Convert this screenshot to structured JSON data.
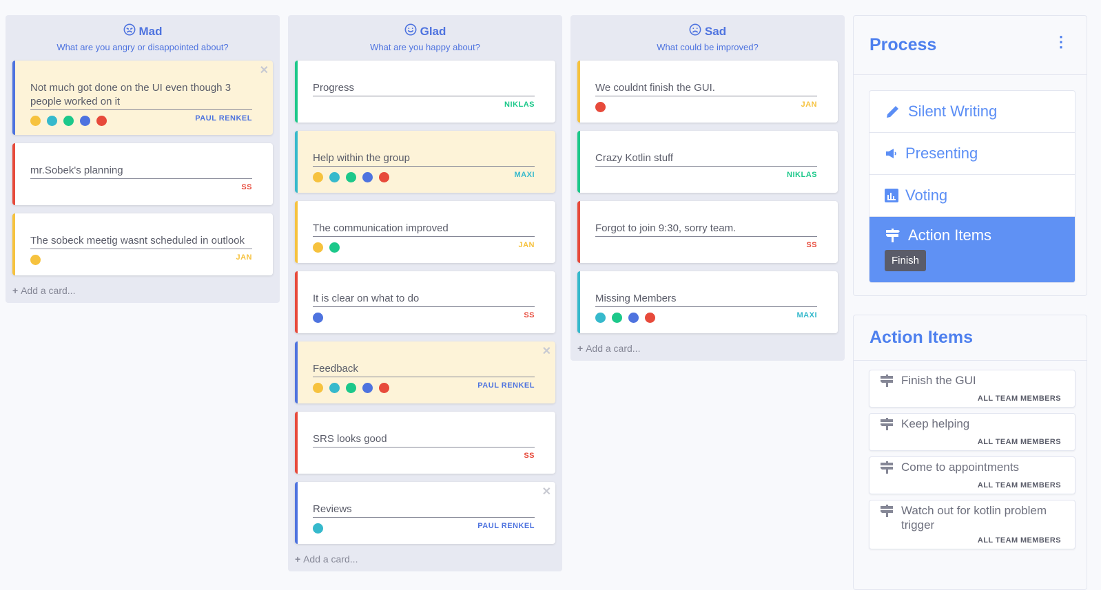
{
  "colors": {
    "yellow": "#f6c23e",
    "teal": "#36b9cc",
    "green": "#1cc88a",
    "blue": "#4e73df",
    "red": "#e74a3b"
  },
  "columns": [
    {
      "title": "Mad",
      "icon": "angry-face-icon",
      "subtitle": "What are you angry or disappointed about?",
      "add_label": "Add a card...",
      "cards": [
        {
          "text": "Not much got done on the UI even though 3 people worked on it",
          "author": "PAUL RENKEL",
          "color": "blue",
          "highlight": true,
          "closable": true,
          "votes": [
            "yellow",
            "teal",
            "green",
            "blue",
            "red"
          ]
        },
        {
          "text": "mr.Sobek's planning",
          "author": "SS",
          "color": "red",
          "votes": []
        },
        {
          "text": "The sobeck meetig wasnt scheduled in outlook",
          "author": "JAN",
          "color": "yellow",
          "votes": [
            "yellow"
          ]
        }
      ]
    },
    {
      "title": "Glad",
      "icon": "smile-face-icon",
      "subtitle": "What are you happy about?",
      "add_label": "Add a card...",
      "cards": [
        {
          "text": "Progress",
          "author": "NIKLAS",
          "color": "green",
          "votes": []
        },
        {
          "text": "Help within the group",
          "author": "MAXI",
          "color": "teal",
          "highlight": true,
          "votes": [
            "yellow",
            "teal",
            "green",
            "blue",
            "red"
          ]
        },
        {
          "text": "The communication improved",
          "author": "JAN",
          "color": "yellow",
          "votes": [
            "yellow",
            "green"
          ]
        },
        {
          "text": "It is clear on what to do",
          "author": "SS",
          "color": "red",
          "votes": [
            "blue"
          ]
        },
        {
          "text": "Feedback",
          "author": "PAUL RENKEL",
          "color": "blue",
          "highlight": true,
          "closable": true,
          "votes": [
            "yellow",
            "teal",
            "green",
            "blue",
            "red"
          ]
        },
        {
          "text": "SRS looks good",
          "author": "SS",
          "color": "red",
          "votes": []
        },
        {
          "text": "Reviews",
          "author": "PAUL RENKEL",
          "color": "blue",
          "closable": true,
          "votes": [
            "teal"
          ]
        }
      ]
    },
    {
      "title": "Sad",
      "icon": "sad-face-icon",
      "subtitle": "What could be improved?",
      "add_label": "Add a card...",
      "cards": [
        {
          "text": "We couldnt finish the GUI.",
          "author": "JAN",
          "color": "yellow",
          "votes": [
            "red"
          ]
        },
        {
          "text": "Crazy Kotlin stuff",
          "author": "NIKLAS",
          "color": "green",
          "votes": []
        },
        {
          "text": "Forgot to join 9:30, sorry team.",
          "author": "SS",
          "color": "red",
          "votes": []
        },
        {
          "text": "Missing Members",
          "author": "MAXI",
          "color": "teal",
          "votes": [
            "teal",
            "green",
            "blue",
            "red"
          ]
        }
      ]
    }
  ],
  "process": {
    "title": "Process",
    "steps": [
      {
        "label": "Silent Writing",
        "icon": "pencil-icon"
      },
      {
        "label": "Presenting",
        "icon": "megaphone-icon"
      },
      {
        "label": "Voting",
        "icon": "bar-chart-icon"
      },
      {
        "label": "Action Items",
        "icon": "signpost-icon",
        "active": true
      }
    ],
    "finish_label": "Finish"
  },
  "action_items": {
    "title": "Action Items",
    "items": [
      {
        "text": "Finish the GUI",
        "owner": "ALL TEAM MEMBERS"
      },
      {
        "text": "Keep helping",
        "owner": "ALL TEAM MEMBERS"
      },
      {
        "text": "Come to appointments",
        "owner": "ALL TEAM MEMBERS"
      },
      {
        "text": "Watch out for kotlin problem trigger",
        "owner": "ALL TEAM MEMBERS"
      }
    ]
  }
}
